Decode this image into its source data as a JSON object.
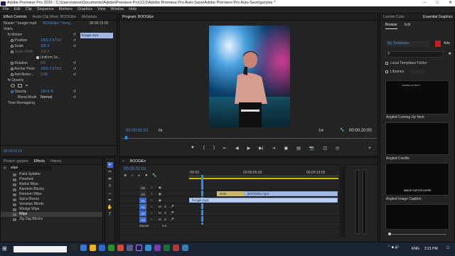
{
  "window": {
    "title": "Adobe Premiere Pro 2020 - C:\\Users\\steve\\Documents\\Adobe\\Premiere Pro\\13.0\\Adobe Premiere Pro Auto-Save\\Adobe Premiere Pro Auto-Save\\garyiee *"
  },
  "menu": [
    "File",
    "Edit",
    "Clip",
    "Sequence",
    "Markers",
    "Graphics",
    "View",
    "Window",
    "Help"
  ],
  "effect_controls": {
    "tabs": [
      "Effect Controls",
      "Audio Clip Mixer: BOOGiEe",
      "Metadata"
    ],
    "master": "Master * boogie mp4",
    "seq": "BOOGiEe * boog...",
    "ruler_time": "00:00:15:00",
    "clip_label": "boogie.mp4",
    "video_label": "Video",
    "props": [
      {
        "name": "Motion",
        "value": ""
      },
      {
        "name": "Position",
        "value": "1001.0   673.0"
      },
      {
        "name": "Scale",
        "value": "100.0"
      },
      {
        "name": "Scale Width",
        "value": "100.0"
      },
      {
        "name": "",
        "value": "Uniform Sc..."
      },
      {
        "name": "Rotation",
        "value": "0.0"
      },
      {
        "name": "Anchor Point",
        "value": "1001.0   673.0"
      },
      {
        "name": "Anti-flicker...",
        "value": "0.00"
      },
      {
        "name": "Opacity",
        "value": ""
      },
      {
        "name": "Opacity",
        "value": "100.0 %"
      },
      {
        "name": "Blend Mode",
        "value": "Normal"
      },
      {
        "name": "Time Remapping",
        "value": ""
      }
    ],
    "timecode": "00:00:01:01"
  },
  "project": {
    "tabs": [
      "Project: garyiee",
      "Effects",
      "History"
    ],
    "search": "wipe",
    "items": [
      "Paint Splatter",
      "Pinwheel",
      "Radial Wipe",
      "Random Blocks",
      "Random Wipe",
      "Spiral Boxes",
      "Venetian Blinds",
      "Wedge Wipe",
      "Wipe",
      "Zig Zag Blocks"
    ]
  },
  "program": {
    "title": "Program: BOOGiEe",
    "timecode": "00:00:01:01",
    "fit": "Fit",
    "fraction": "1/4",
    "duration": "00:00:20:00"
  },
  "graphics": {
    "tabs": [
      "Lumetri Color",
      "Essential Graphics"
    ],
    "sub_tabs": [
      "Browse",
      "Edit"
    ],
    "dropdown": "My Templates",
    "adobe_label": "Ado",
    "local_folder": "Local Templates Folder",
    "libraries": "Libraries",
    "templates": [
      "Angled Coming Up Next",
      "Angled Credits",
      "Angled Image Caption"
    ],
    "thumb_texts": [
      "COMING UP NEXT",
      "IMAGE CAPTION HERE"
    ]
  },
  "timeline": {
    "title": "BOOGiEe",
    "timecode": "00:00:01:01",
    "ruler": [
      ":00:00",
      "00:00:05:00",
      "00:00:10:00"
    ],
    "video_tracks": [
      "V3",
      "V2",
      "V1"
    ],
    "audio_tracks": [
      "A1",
      "A2",
      "A3"
    ],
    "master_label": "Master",
    "master_val": "0.0",
    "clips": {
      "v2a": "Cros",
      "v2b": "BOOGiEe.mp4",
      "v1": "boogie.mp4"
    }
  },
  "taskbar": {
    "lang": "ENG",
    "time": "2:21 PM"
  },
  "colors": {
    "accent": "#4f8fd8",
    "clip": "#9fb8e6",
    "timeline_playhead": "#2d8ceb"
  }
}
